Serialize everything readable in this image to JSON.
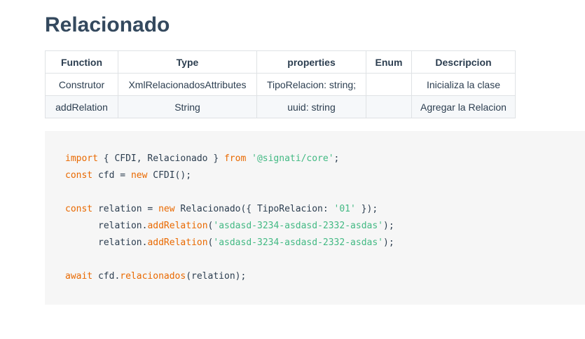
{
  "heading": "Relacionado",
  "table": {
    "headers": {
      "function": "Function",
      "type": "Type",
      "properties": "properties",
      "enum": "Enum",
      "descripcion": "Descripcion"
    },
    "rows": [
      {
        "function": "Construtor",
        "type": "XmlRelacionadosAttributes",
        "properties": "TipoRelacion: string;",
        "enum": "",
        "descripcion": "Inicializa la clase"
      },
      {
        "function": "addRelation",
        "type": "String",
        "properties": "uuid: string",
        "enum": "",
        "descripcion": "Agregar la Relacion"
      }
    ]
  },
  "code": {
    "l1": {
      "kw_import": "import",
      "t1": " { CFDI, Relacionado } ",
      "kw_from": "from",
      "sp": " ",
      "str": "'@signati/core'",
      "end": ";"
    },
    "l2": {
      "kw_const": "const",
      "t1": " cfd = ",
      "kw_new": "new",
      "t2": " CFDI();"
    },
    "l4": {
      "kw_const": "const",
      "t1": " relation = ",
      "kw_new": "new",
      "t2": " Relacionado({ TipoRelacion: ",
      "str": "'01'",
      "t3": " });"
    },
    "l5": {
      "t1": "relation.",
      "fn": "addRelation",
      "t2": "(",
      "str": "'asdasd-3234-asdasd-2332-asdas'",
      "t3": ");"
    },
    "l6": {
      "t1": "relation.",
      "fn": "addRelation",
      "t2": "(",
      "str": "'asdasd-3234-asdasd-2332-asdas'",
      "t3": ");"
    },
    "l8": {
      "kw_await": "await",
      "t1": " cfd.",
      "fn": "relacionados",
      "t2": "(relation);"
    }
  },
  "colors": {
    "keyword": "#e96900",
    "string": "#42b983",
    "text": "#2c3e50",
    "code_bg": "#f6f6f6"
  }
}
